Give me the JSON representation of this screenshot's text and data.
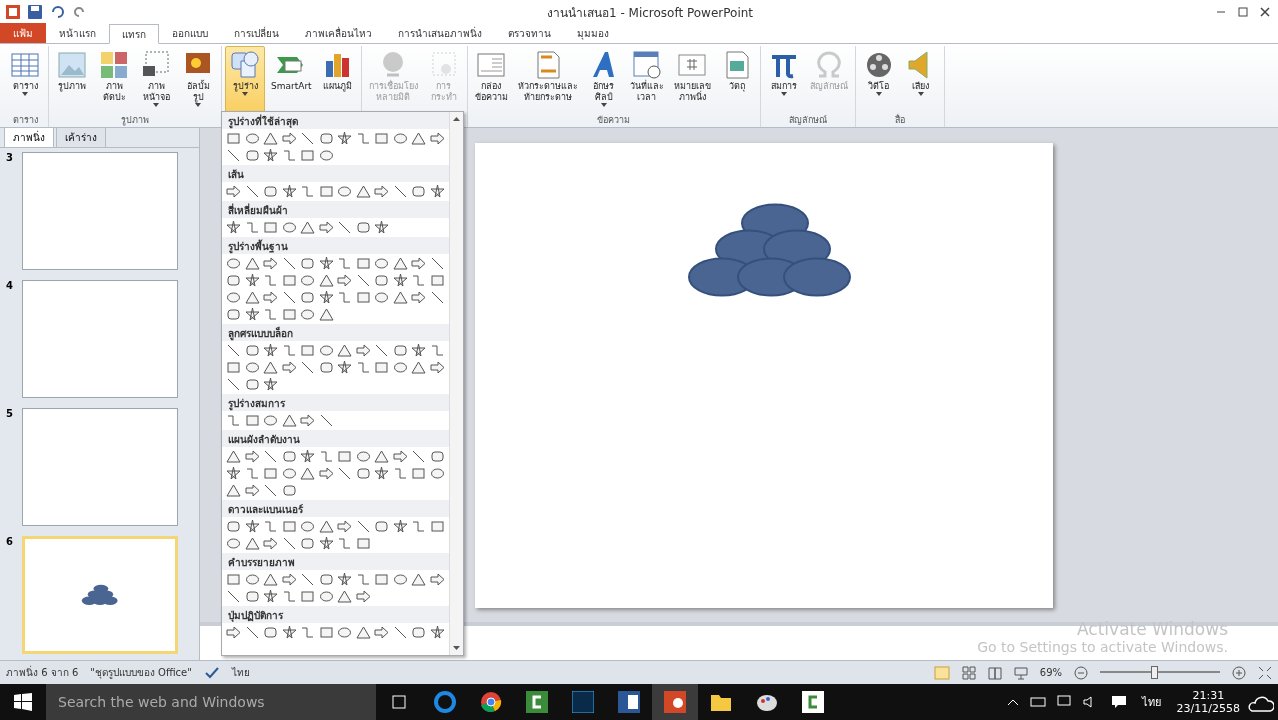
{
  "window": {
    "title": "งานนำเสนอ1 - Microsoft PowerPoint"
  },
  "tabs": [
    {
      "label": "แฟ้ม",
      "kind": "file",
      "selected": false
    },
    {
      "label": "หน้าแรก",
      "kind": "tab",
      "selected": false
    },
    {
      "label": "แทรก",
      "kind": "tab",
      "selected": true
    },
    {
      "label": "ออกแบบ",
      "kind": "tab",
      "selected": false
    },
    {
      "label": "การเปลี่ยน",
      "kind": "tab",
      "selected": false
    },
    {
      "label": "ภาพเคลื่อนไหว",
      "kind": "tab",
      "selected": false
    },
    {
      "label": "การนำเสนอภาพนิ่ง",
      "kind": "tab",
      "selected": false
    },
    {
      "label": "ตรวจทาน",
      "kind": "tab",
      "selected": false
    },
    {
      "label": "มุมมอง",
      "kind": "tab",
      "selected": false
    }
  ],
  "ribbon_groups": [
    {
      "label": "ตาราง",
      "buttons": [
        {
          "label": "ตาราง",
          "dropdown": true,
          "disabled": false,
          "pressed": false
        }
      ]
    },
    {
      "label": "รูปภาพ",
      "buttons": [
        {
          "label": "รูปภาพ",
          "dropdown": false,
          "disabled": false,
          "pressed": false
        },
        {
          "label": "ภาพ\nตัดปะ",
          "dropdown": false,
          "disabled": false,
          "pressed": false
        },
        {
          "label": "ภาพ\nหน้าจอ",
          "dropdown": true,
          "disabled": false,
          "pressed": false
        },
        {
          "label": "อัลบั้ม\nรูป",
          "dropdown": true,
          "disabled": false,
          "pressed": false
        }
      ]
    },
    {
      "buttons": [
        {
          "label": "รูปร่าง",
          "dropdown": true,
          "disabled": false,
          "pressed": true
        },
        {
          "label": "SmartArt",
          "dropdown": false,
          "disabled": false,
          "pressed": false
        },
        {
          "label": "แผนภูมิ",
          "dropdown": false,
          "disabled": false,
          "pressed": false
        }
      ]
    },
    {
      "buttons": [
        {
          "label": "การเชื่อมโยง\nหลายมิติ",
          "dropdown": false,
          "disabled": true,
          "pressed": false
        },
        {
          "label": "การ\nกระทำ",
          "dropdown": false,
          "disabled": true,
          "pressed": false
        }
      ]
    },
    {
      "label": "ข้อความ",
      "buttons": [
        {
          "label": "กล่อง\nข้อความ",
          "dropdown": false,
          "disabled": false,
          "pressed": false
        },
        {
          "label": "หัวกระดาษและ\nท้ายกระดาษ",
          "dropdown": false,
          "disabled": false,
          "pressed": false
        },
        {
          "label": "อักษร\nศิลป์",
          "dropdown": true,
          "disabled": false,
          "pressed": false
        },
        {
          "label": "วันที่และ\nเวลา",
          "dropdown": false,
          "disabled": false,
          "pressed": false
        },
        {
          "label": "หมายเลข\nภาพนิ่ง",
          "dropdown": false,
          "disabled": false,
          "pressed": false
        },
        {
          "label": "วัตถุ",
          "dropdown": false,
          "disabled": false,
          "pressed": false
        }
      ]
    },
    {
      "label": "สัญลักษณ์",
      "buttons": [
        {
          "label": "สมการ",
          "dropdown": true,
          "disabled": false,
          "pressed": false
        },
        {
          "label": "สัญลักษณ์",
          "dropdown": false,
          "disabled": true,
          "pressed": false
        }
      ]
    },
    {
      "label": "สื่อ",
      "buttons": [
        {
          "label": "วิดีโอ",
          "dropdown": true,
          "disabled": false,
          "pressed": false
        },
        {
          "label": "เสียง",
          "dropdown": true,
          "disabled": false,
          "pressed": false
        }
      ]
    }
  ],
  "panel_tabs": [
    {
      "label": "ภาพนิ่ง",
      "selected": true
    },
    {
      "label": "เค้าร่าง",
      "selected": false
    }
  ],
  "slides": [
    {
      "number": "3",
      "selected": false,
      "has_shapes": false
    },
    {
      "number": "4",
      "selected": false,
      "has_shapes": false
    },
    {
      "number": "5",
      "selected": false,
      "has_shapes": false
    },
    {
      "number": "6",
      "selected": true,
      "has_shapes": true
    }
  ],
  "shape_gallery": {
    "sections": [
      {
        "title": "รูปร่างที่ใช้ล่าสุด"
      },
      {
        "title": "เส้น"
      },
      {
        "title": "สี่เหลี่ยมผืนผ้า"
      },
      {
        "title": "รูปร่างพื้นฐาน"
      },
      {
        "title": "ลูกศรแบบบล็อก"
      },
      {
        "title": "รูปร่างสมการ"
      },
      {
        "title": "แผนผังลำดับงาน"
      },
      {
        "title": "ดาวและแบนเนอร์"
      },
      {
        "title": "คำบรรยายภาพ"
      },
      {
        "title": "ปุ่มปฏิบัติการ"
      }
    ]
  },
  "watermark_os": {
    "title": "Activate Windows",
    "text": "Go to Settings to activate Windows."
  },
  "status_bar": {
    "slide_info": "ภาพนิ่ง 6 จาก 6",
    "theme": "\"ชุดรูปแบบของ Office\"",
    "language": "ไทย",
    "zoom": "69%",
    "zoom_slider": {
      "level": 0.45
    }
  },
  "taskbar": {
    "search_placeholder": "Search the web and Windows",
    "input_language": "ไทย",
    "time": "21:31",
    "date": "23/11/2558"
  }
}
